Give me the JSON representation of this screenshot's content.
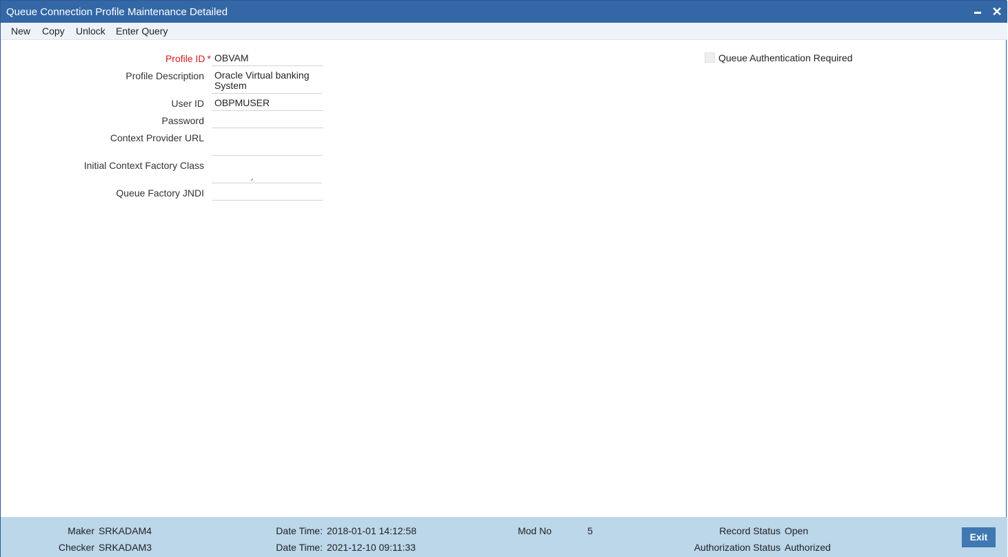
{
  "window": {
    "title": "Queue Connection Profile Maintenance Detailed"
  },
  "toolbar": {
    "new_label": "New",
    "copy_label": "Copy",
    "unlock_label": "Unlock",
    "enter_query_label": "Enter Query"
  },
  "form": {
    "profile_id": {
      "label": "Profile ID",
      "required_mark": "*",
      "value": "OBVAM"
    },
    "profile_description": {
      "label": "Profile Description",
      "value_line1": "Oracle Virtual banking",
      "value_line2": "System"
    },
    "user_id": {
      "label": "User ID",
      "value": "OBPMUSER"
    },
    "password": {
      "label": "Password",
      "value": ""
    },
    "context_provider_url": {
      "label": "Context Provider URL",
      "value": ""
    },
    "initial_context_factory_class": {
      "label": "Initial Context Factory Class",
      "value": ""
    },
    "queue_factory_jndi": {
      "label": "Queue Factory JNDI",
      "value": ""
    },
    "queue_auth_required": {
      "label": "Queue Authentication Required",
      "checked": false
    }
  },
  "footer": {
    "maker_label": "Maker",
    "maker_value": "SRKADAM4",
    "checker_label": "Checker",
    "checker_value": "SRKADAM3",
    "maker_datetime_label": "Date Time:",
    "maker_datetime_value": "2018-01-01 14:12:58",
    "checker_datetime_label": "Date Time:",
    "checker_datetime_value": "2021-12-10 09:11:33",
    "mod_no_label": "Mod No",
    "mod_no_value": "5",
    "record_status_label": "Record Status",
    "record_status_value": "Open",
    "authorization_status_label": "Authorization Status",
    "authorization_status_value": "Authorized",
    "exit_label": "Exit"
  },
  "colors": {
    "titlebar": "#3467a6",
    "toolbar": "#eef3fa",
    "footer": "#bcd6ea",
    "required_label": "#d0191c",
    "exit_button": "#3f78b3"
  }
}
